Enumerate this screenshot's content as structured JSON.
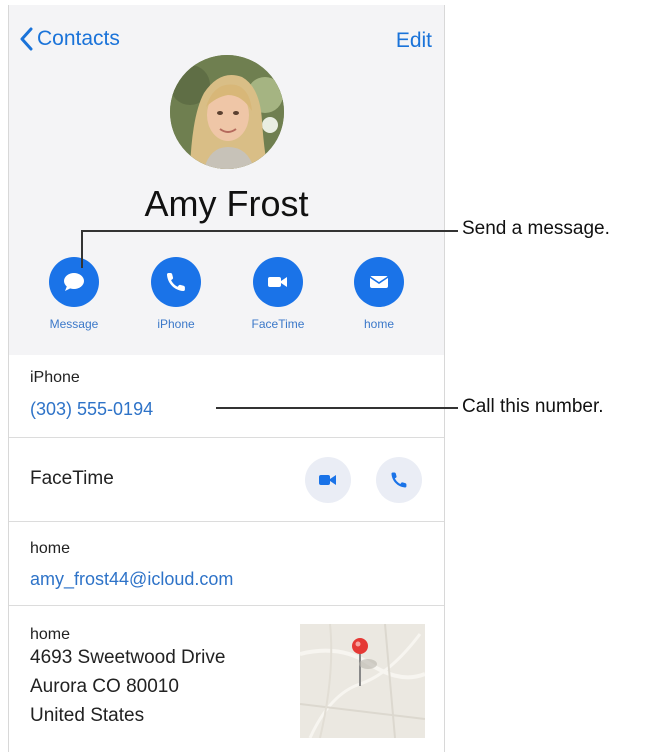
{
  "nav": {
    "back_label": "Contacts",
    "edit_label": "Edit"
  },
  "contact": {
    "name": "Amy Frost"
  },
  "actions": [
    {
      "label": "Message",
      "icon": "message-icon"
    },
    {
      "label": "iPhone",
      "icon": "phone-icon"
    },
    {
      "label": "FaceTime",
      "icon": "video-icon"
    },
    {
      "label": "home",
      "icon": "mail-icon"
    }
  ],
  "phone_section": {
    "label": "iPhone",
    "number": "(303) 555-0194"
  },
  "facetime_section": {
    "title": "FaceTime"
  },
  "email_section": {
    "label": "home",
    "email": "amy_frost44@icloud.com"
  },
  "address_section": {
    "label": "home",
    "lines": [
      "4693 Sweetwood Drive",
      "Aurora CO 80010",
      "United States"
    ]
  },
  "callouts": {
    "message": "Send a message.",
    "call": "Call this number."
  },
  "colors": {
    "accent": "#1a73e8",
    "link": "#2e73c8",
    "header_bg": "#f4f4f6",
    "map_pin": "#e53935"
  }
}
